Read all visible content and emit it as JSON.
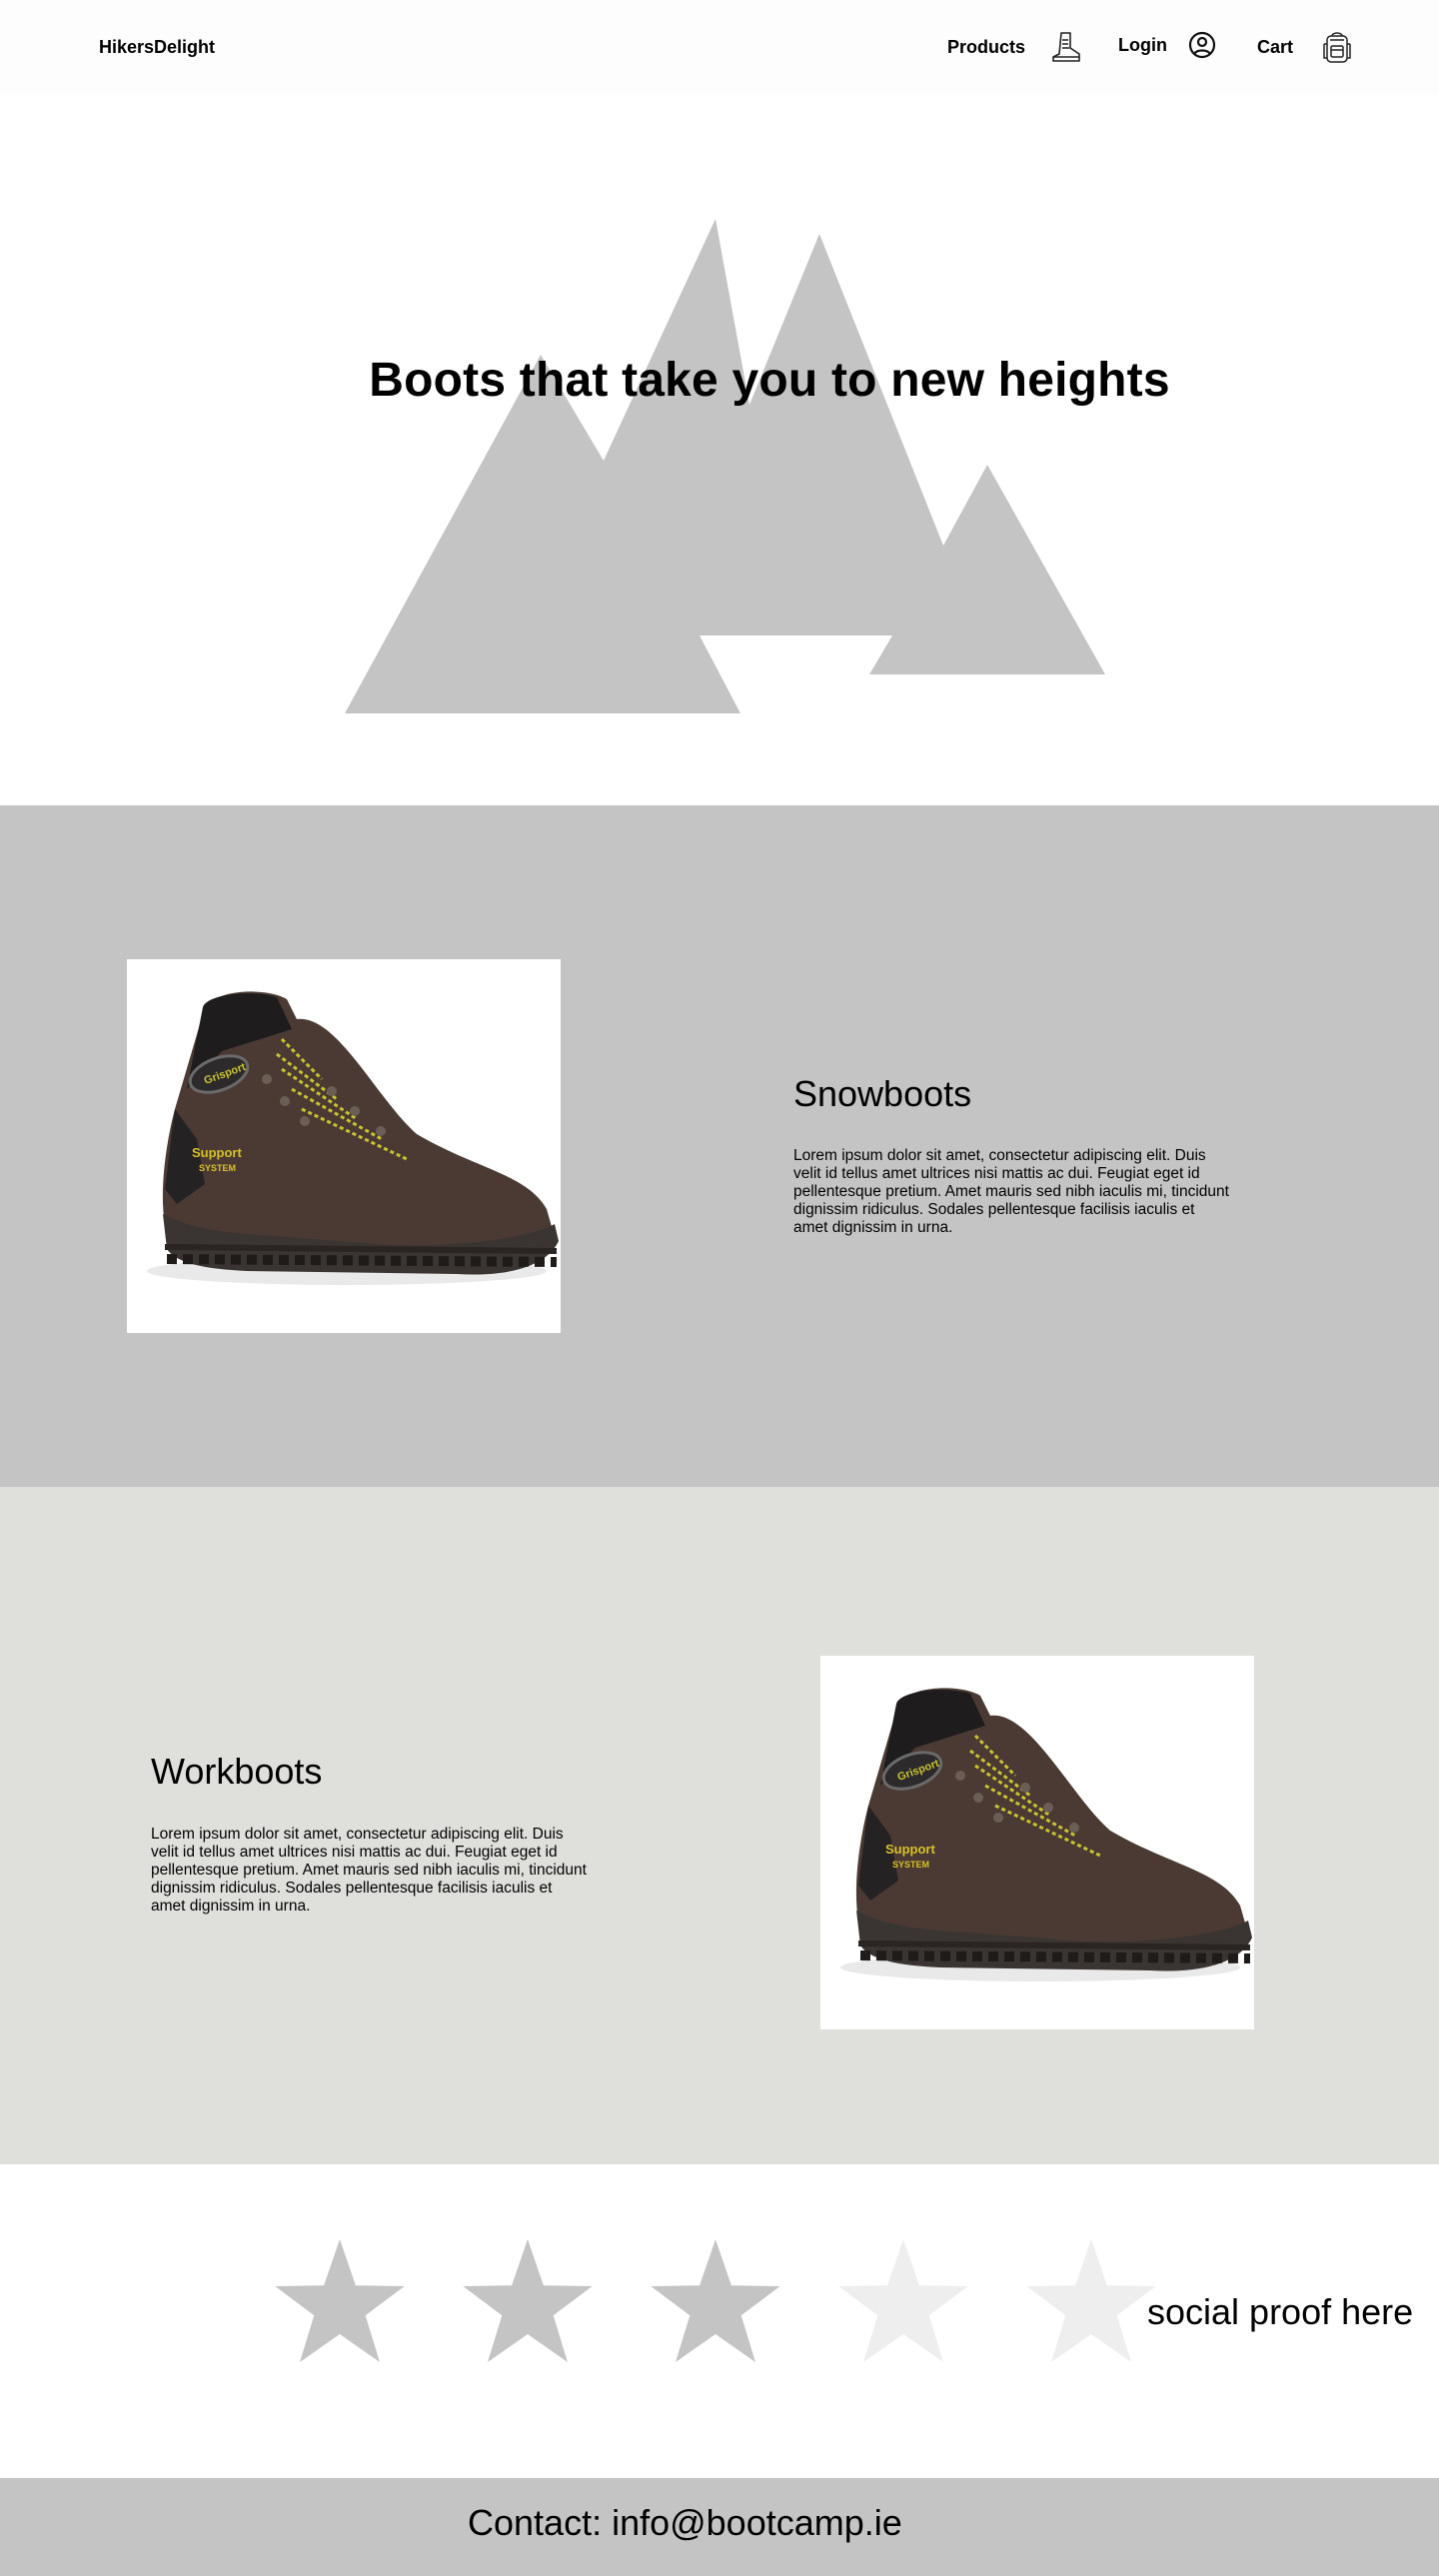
{
  "header": {
    "logo": "HikersDelight",
    "nav": {
      "products": "Products",
      "login": "Login",
      "cart": "Cart"
    }
  },
  "hero": {
    "title": "Boots that take you to new heights"
  },
  "products": [
    {
      "heading": "Snowboots",
      "text": "Lorem ipsum dolor sit amet, consectetur adipiscing elit. Duis velit id tellus amet ultrices nisi mattis ac dui. Feugiat eget id pellentesque pretium. Amet mauris sed nibh iaculis mi, tincidunt dignissim ridiculus. Sodales pellentesque facilisis iaculis et amet dignissim in urna.",
      "boot_logo": "Grisport",
      "boot_tag_line1": "Support",
      "boot_tag_line2": "SYSTEM"
    },
    {
      "heading": "Workboots",
      "text": "Lorem ipsum dolor sit amet, consectetur adipiscing elit. Duis velit id tellus amet ultrices nisi mattis ac dui. Feugiat eget id pellentesque pretium. Amet mauris sed nibh iaculis mi, tincidunt dignissim ridiculus. Sodales pellentesque facilisis iaculis et amet dignissim in urna.",
      "boot_logo": "Grisport",
      "boot_tag_line1": "Support",
      "boot_tag_line2": "SYSTEM"
    }
  ],
  "social_proof": {
    "rating": 3,
    "max": 5,
    "filled_color": "#c4c4c4",
    "empty_color": "#eeeeee",
    "text": "social proof here"
  },
  "footer": {
    "contact": "Contact: info@bootcamp.ie"
  },
  "colors": {
    "accent_gray": "#c4c4c4",
    "section_alt": "#dfe0dc",
    "boot_leather": "#4a3a33",
    "lace_yellow": "#c9c431"
  },
  "icons": {
    "products": "boot-icon",
    "login": "user-circle-icon",
    "cart": "backpack-icon"
  }
}
